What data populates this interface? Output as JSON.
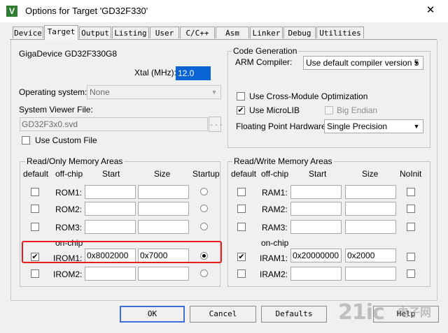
{
  "window": {
    "title": "Options for Target 'GD32F330'",
    "close_glyph": "✕",
    "app_icon_glyph": "V"
  },
  "tabs": [
    {
      "label": "Device",
      "active": false
    },
    {
      "label": "Target",
      "active": true
    },
    {
      "label": "Output",
      "active": false
    },
    {
      "label": "Listing",
      "active": false
    },
    {
      "label": "User",
      "active": false
    },
    {
      "label": "C/C++",
      "active": false
    },
    {
      "label": "Asm",
      "active": false
    },
    {
      "label": "Linker",
      "active": false
    },
    {
      "label": "Debug",
      "active": false
    },
    {
      "label": "Utilities",
      "active": false
    }
  ],
  "device": {
    "name": "GigaDevice GD32F330G8",
    "xtal_label": "Xtal (MHz):",
    "xtal_value": "12.0",
    "os_label": "Operating system:",
    "os_value": "None",
    "svd_label": "System Viewer File:",
    "svd_value": "GD32F3x0.svd",
    "browse_label": "...",
    "custom_file_label": "Use Custom File"
  },
  "codegen": {
    "group_label": "Code Generation",
    "compiler_label": "ARM Compiler:",
    "compiler_value": "Use default compiler version 5",
    "cross_module_label": "Use Cross-Module Optimization",
    "microlib_label": "Use MicroLIB",
    "big_endian_label": "Big Endian",
    "fp_label": "Floating Point Hardware:",
    "fp_value": "Single Precision"
  },
  "rom": {
    "group_label": "Read/Only Memory Areas",
    "headers": {
      "default": "default",
      "offchip": "off-chip",
      "start": "Start",
      "size": "Size",
      "startup": "Startup"
    },
    "onchip_label": "on-chip",
    "rows": [
      {
        "name": "ROM1:",
        "start": "",
        "size": "",
        "default": false,
        "startup": false
      },
      {
        "name": "ROM2:",
        "start": "",
        "size": "",
        "default": false,
        "startup": false
      },
      {
        "name": "ROM3:",
        "start": "",
        "size": "",
        "default": false,
        "startup": false
      },
      {
        "name": "IROM1:",
        "start": "0x8002000",
        "size": "0x7000",
        "default": true,
        "startup": true
      },
      {
        "name": "IROM2:",
        "start": "",
        "size": "",
        "default": false,
        "startup": false
      }
    ]
  },
  "ram": {
    "group_label": "Read/Write Memory Areas",
    "headers": {
      "default": "default",
      "offchip": "off-chip",
      "start": "Start",
      "size": "Size",
      "noinit": "NoInit"
    },
    "onchip_label": "on-chip",
    "rows": [
      {
        "name": "RAM1:",
        "start": "",
        "size": "",
        "default": false
      },
      {
        "name": "RAM2:",
        "start": "",
        "size": "",
        "default": false
      },
      {
        "name": "RAM3:",
        "start": "",
        "size": "",
        "default": false
      },
      {
        "name": "IRAM1:",
        "start": "0x20000000",
        "size": "0x2000",
        "default": true
      },
      {
        "name": "IRAM2:",
        "start": "",
        "size": "",
        "default": false
      }
    ]
  },
  "buttons": {
    "ok": "OK",
    "cancel": "Cancel",
    "defaults": "Defaults",
    "help": "Help"
  },
  "watermark": {
    "text": "21ic",
    "sub": "电子网"
  },
  "colors": {
    "highlight": "#e81e1e",
    "selection": "#0a64d6"
  }
}
